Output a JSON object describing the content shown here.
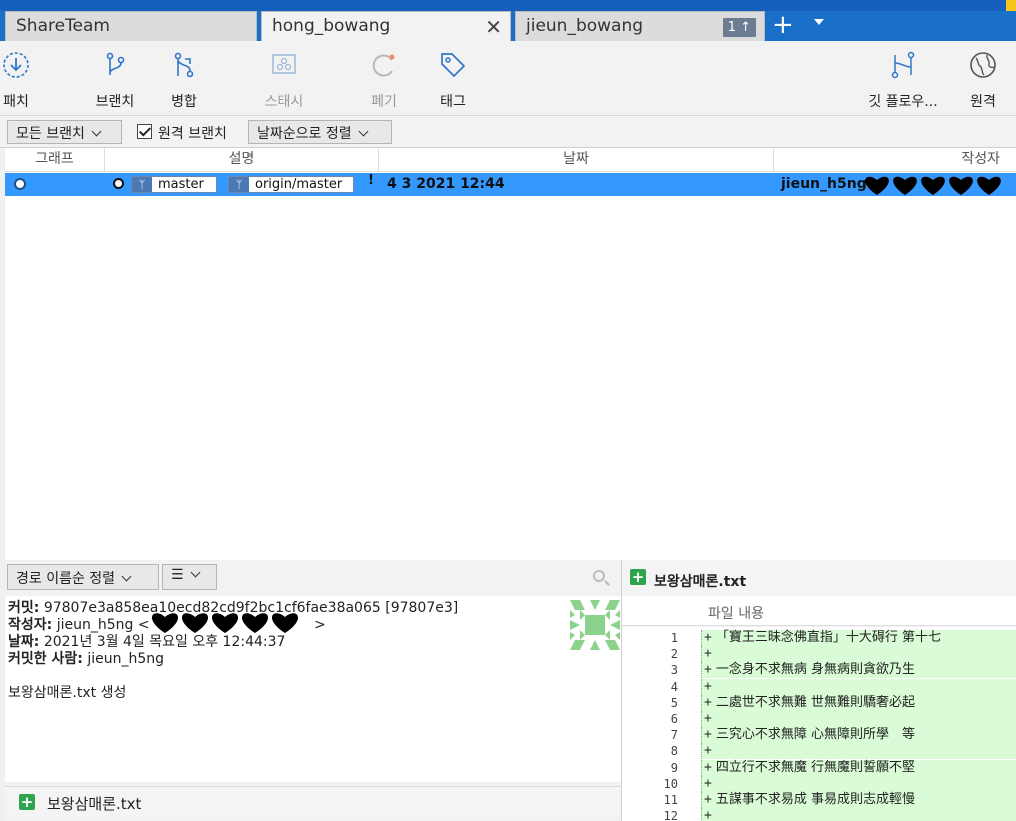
{
  "tabs": [
    {
      "label": "ShareTeam"
    },
    {
      "label": "hong_bowang"
    },
    {
      "label": "jieun_bowang",
      "badge": "1 ↑"
    }
  ],
  "toolbar": {
    "patch": "패치",
    "branch": "브랜치",
    "merge": "병합",
    "stash": "스태시",
    "discard": "폐기",
    "tag": "태그",
    "gitflow": "깃 플로우...",
    "remote": "원격"
  },
  "filter": {
    "all_branches": "모든 브랜치",
    "remote_branches": "원격 브랜치",
    "sort_by_date": "날짜순으로 정렬"
  },
  "columns": {
    "graph": "그래프",
    "description": "설명",
    "date": "날짜",
    "author": "작성자"
  },
  "commit_row": {
    "branch_local": "master",
    "branch_remote": "origin/master",
    "date": "4 3 2021 12:44",
    "author": "jieun_h5ng"
  },
  "lower": {
    "sort_by_path": "경로 이름순 정렬",
    "list_icon": "☰"
  },
  "details": {
    "commit_label": "커밋:",
    "commit_value": "97807e3a858ea10ecd82cd9f2bc1cf6fae38a065 [97807e3]",
    "author_label": "작성자:",
    "author_value": "jieun_h5ng <",
    "author_end": ">",
    "date_label": "날짜:",
    "date_value": "2021년 3월 4일 목요일 오후 12:44:37",
    "committer_label": "커밋한 사람:",
    "committer_value": "jieun_h5ng",
    "message": "보왕삼매론.txt 생성"
  },
  "file_list": [
    {
      "name": "보왕삼매론.txt",
      "status": "added"
    }
  ],
  "diff": {
    "filename": "보왕삼매론.txt",
    "content_header": "파일 내용",
    "lines": [
      {
        "n": "1",
        "t": "「寶王三昧念佛直指」十大碍行 第十七"
      },
      {
        "n": "2",
        "t": ""
      },
      {
        "n": "3",
        "t": "一念身不求無病 身無病則貪欲乃生"
      },
      {
        "n": "4",
        "t": ""
      },
      {
        "n": "5",
        "t": "二處世不求無難 世無難則驕奢必起"
      },
      {
        "n": "6",
        "t": ""
      },
      {
        "n": "7",
        "t": "三究心不求無障 心無障則所學　等"
      },
      {
        "n": "8",
        "t": ""
      },
      {
        "n": "9",
        "t": "四立行不求無魔 行無魔則誓願不堅"
      },
      {
        "n": "10",
        "t": ""
      },
      {
        "n": "11",
        "t": "五謀事不求易成 事易成則志成輕慢"
      },
      {
        "n": "12",
        "t": ""
      }
    ]
  },
  "colors": {
    "accent": "#1a6fc9",
    "selection": "#3399ff",
    "added_bg": "#d9fbd5",
    "added_icon": "#2ea44f"
  }
}
